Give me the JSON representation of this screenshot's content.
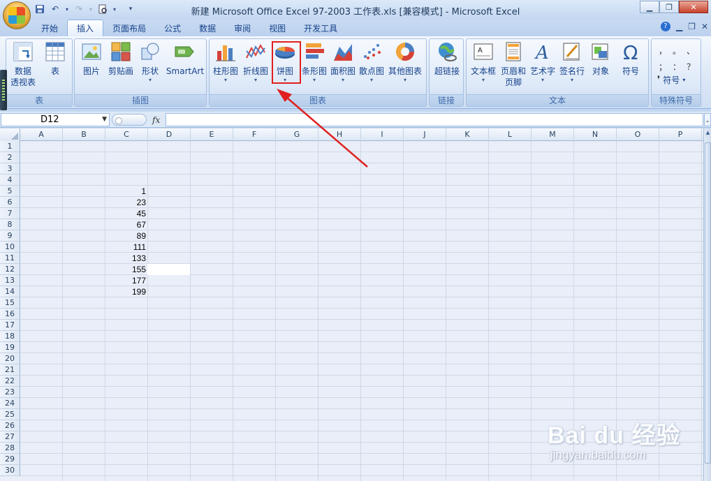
{
  "window": {
    "title": "新建 Microsoft Office Excel 97-2003 工作表.xls  [兼容模式] - Microsoft Excel",
    "controls": [
      "minimize",
      "restore",
      "close"
    ]
  },
  "tabs": [
    {
      "label": "开始",
      "active": false
    },
    {
      "label": "插入",
      "active": true
    },
    {
      "label": "页面布局",
      "active": false
    },
    {
      "label": "公式",
      "active": false
    },
    {
      "label": "数据",
      "active": false
    },
    {
      "label": "审阅",
      "active": false
    },
    {
      "label": "视图",
      "active": false
    },
    {
      "label": "开发工具",
      "active": false
    }
  ],
  "ribbon": {
    "groups": [
      {
        "label": "表",
        "buttons": [
          {
            "label": "数据",
            "label2": "透视表",
            "icon": "pivot-table-icon"
          },
          {
            "label": "表",
            "icon": "table-icon"
          }
        ]
      },
      {
        "label": "插图",
        "buttons": [
          {
            "label": "图片",
            "icon": "picture-icon"
          },
          {
            "label": "剪贴画",
            "icon": "clipart-icon"
          },
          {
            "label": "形状",
            "icon": "shapes-icon"
          },
          {
            "label": "SmartArt",
            "icon": "smartart-icon"
          }
        ]
      },
      {
        "label": "图表",
        "buttons": [
          {
            "label": "柱形图",
            "icon": "column-chart-icon"
          },
          {
            "label": "折线图",
            "icon": "line-chart-icon"
          },
          {
            "label": "饼图",
            "icon": "pie-chart-icon"
          },
          {
            "label": "条形图",
            "icon": "bar-chart-icon"
          },
          {
            "label": "面积图",
            "icon": "area-chart-icon"
          },
          {
            "label": "散点图",
            "icon": "scatter-chart-icon"
          },
          {
            "label": "其他图表",
            "icon": "other-charts-icon"
          }
        ]
      },
      {
        "label": "链接",
        "buttons": [
          {
            "label": "超链接",
            "icon": "hyperlink-icon"
          }
        ]
      },
      {
        "label": "文本",
        "buttons": [
          {
            "label": "文本框",
            "icon": "textbox-icon"
          },
          {
            "label": "页眉和",
            "label2": "页脚",
            "icon": "header-footer-icon"
          },
          {
            "label": "艺术字",
            "icon": "wordart-icon"
          },
          {
            "label": "签名行",
            "icon": "signature-line-icon"
          },
          {
            "label": "对象",
            "icon": "object-icon"
          },
          {
            "label": "符号",
            "icon": "omega-symbol-icon"
          }
        ]
      },
      {
        "label": "特殊符号",
        "buttons": [
          {
            "label": "符号",
            "icon": "special-symbol-icon"
          }
        ],
        "symbols": [
          "，",
          "。",
          "、",
          "；",
          "：",
          "？"
        ]
      }
    ]
  },
  "formula_bar": {
    "name_box": "D12",
    "fx": "fx",
    "value": ""
  },
  "sheet": {
    "columns": [
      "A",
      "B",
      "C",
      "D",
      "E",
      "F",
      "G",
      "H",
      "I",
      "J",
      "K",
      "L",
      "M",
      "N",
      "O",
      "P"
    ],
    "rows": [
      "1",
      "2",
      "3",
      "4",
      "5",
      "6",
      "7",
      "8",
      "9",
      "10",
      "11",
      "12",
      "13",
      "14",
      "15",
      "16",
      "17",
      "18",
      "19",
      "20",
      "21",
      "22",
      "23",
      "24",
      "25",
      "26",
      "27",
      "28",
      "29",
      "30"
    ],
    "active_cell": "D12",
    "column_c_values": [
      {
        "row": 5,
        "value": "1"
      },
      {
        "row": 6,
        "value": "23"
      },
      {
        "row": 7,
        "value": "45"
      },
      {
        "row": 8,
        "value": "67"
      },
      {
        "row": 9,
        "value": "89"
      },
      {
        "row": 10,
        "value": "111"
      },
      {
        "row": 11,
        "value": "133"
      },
      {
        "row": 12,
        "value": "155"
      },
      {
        "row": 13,
        "value": "177"
      },
      {
        "row": 14,
        "value": "199"
      }
    ]
  },
  "watermark": {
    "brand": "Bai du 经验",
    "url": "jingyan.baidu.com"
  },
  "colors": {
    "highlight": "#e0201f",
    "arrow": "#e0201f"
  }
}
